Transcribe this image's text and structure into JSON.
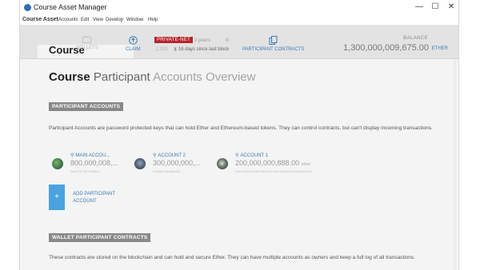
{
  "window": {
    "title": "Course Asset Manager",
    "controls": {
      "minimize": "—",
      "maximize": "☐",
      "close": "✕"
    }
  },
  "menu": {
    "items": [
      "Course Asset",
      "Accounts",
      "Edit",
      "View",
      "Develop",
      "Window",
      "Help"
    ]
  },
  "header": {
    "course_label": "Course",
    "wallets_label": "WALLETS",
    "claim_label": "CLAIM",
    "network_badge": "PRIVATE-NET",
    "peers": "2 peers",
    "block_number": "1,315",
    "since_last_block": "16 days since last block",
    "contracts_label": "PARTICIPANT CONTRACTS",
    "balance_label": "BALANCE",
    "balance_value": "1,300,000,009,675.00",
    "balance_unit": "ETHER"
  },
  "page": {
    "title_part1": "Course",
    "title_part2": "Participant",
    "title_part3": "Accounts Overview"
  },
  "participant_accounts": {
    "heading": "PARTICIPANT ACCOUNTS",
    "description": "Participant Accounts are password protected keys that can hold Ether and Ethereum-based tokens. They can control contracts, but can't display incoming transactions.",
    "accounts": [
      {
        "name": "MAIN ACCOU...",
        "balance": "800,000,008,...",
        "unit": "",
        "address": "0x6176C7B7289914..."
      },
      {
        "name": "ACCOUNT 2",
        "balance": "300,000,000,...",
        "unit": "",
        "address": "0xa0b9C6bd82d06..."
      },
      {
        "name": "ACCOUNT 1",
        "balance": "200,000,000,888.00",
        "unit": "ether",
        "address": "0x8C9FAcc0D82E8B3C1C16C40D55FACA4B0D5011"
      }
    ],
    "add_button": "+",
    "add_label": "ADD PARTICIPANT ACCOUNT"
  },
  "wallet_contracts": {
    "heading": "WALLET PARTICIPANT CONTRACTS",
    "description": "These contracts are stored on the blockchain and can hold and secure Ether. They can have multiple accounts as owners and keep a full log of all transactions."
  },
  "colors": {
    "accent": "#3a79b8",
    "network_badge": "#b5252b",
    "add_button": "#4aa3df",
    "section_head": "#888888"
  },
  "icons": [
    "app-icon",
    "wallet-icon",
    "claim-icon",
    "contracts-icon",
    "key-icon",
    "hourglass-icon",
    "peers-icon"
  ]
}
